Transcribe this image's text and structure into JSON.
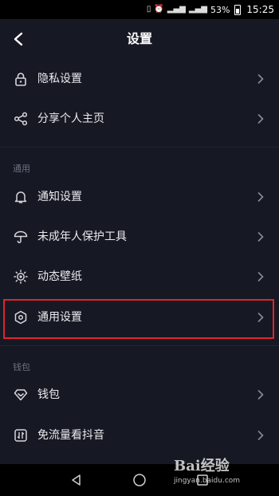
{
  "status": {
    "battery": "53%",
    "time": "15:25"
  },
  "header": {
    "title": "设置"
  },
  "sections": {
    "general": "通用",
    "wallet": "钱包"
  },
  "items": [
    {
      "label": "隐私设置",
      "icon": "lock-icon"
    },
    {
      "label": "分享个人主页",
      "icon": "share-icon"
    },
    {
      "label": "通知设置",
      "icon": "bell-icon"
    },
    {
      "label": "未成年人保护工具",
      "icon": "umbrella-icon"
    },
    {
      "label": "动态壁纸",
      "icon": "wallpaper-icon"
    },
    {
      "label": "通用设置",
      "icon": "hexagon-icon"
    },
    {
      "label": "钱包",
      "icon": "diamond-icon"
    },
    {
      "label": "免流量看抖音",
      "icon": "data-icon"
    }
  ],
  "watermark": {
    "logo": "Bai经验",
    "url": "jingyan.baidu.com"
  },
  "colors": {
    "background": "#161823",
    "highlight": "#e0242f"
  }
}
